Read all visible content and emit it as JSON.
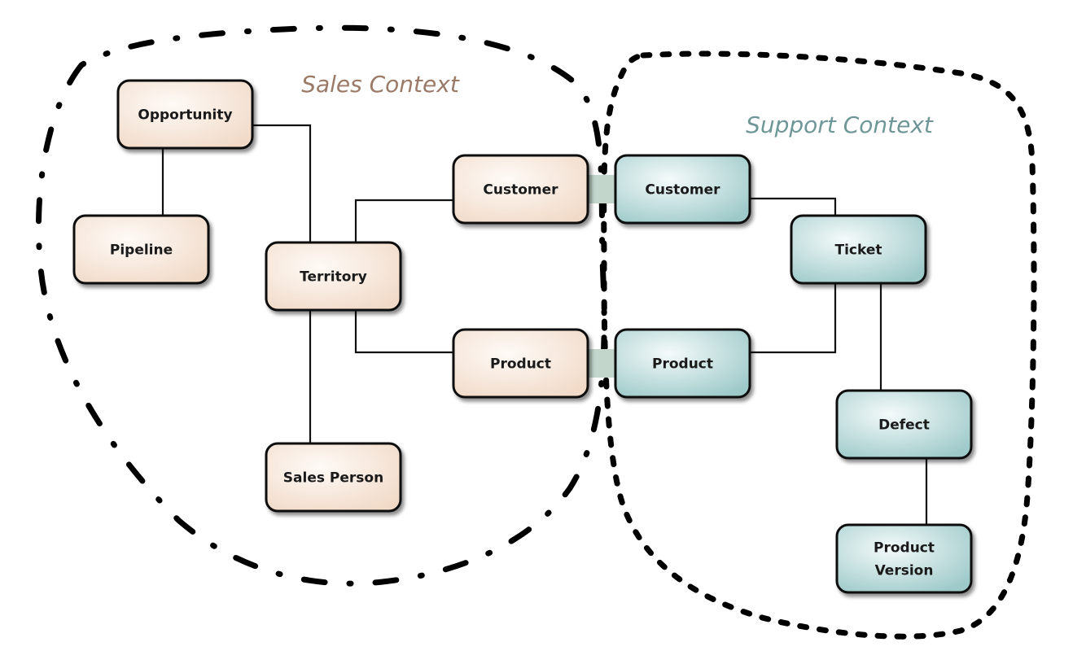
{
  "contexts": [
    {
      "id": "sales",
      "title": "Sales Context",
      "title_color": "#9b7a68",
      "boundary_style": "dash-dot"
    },
    {
      "id": "support",
      "title": "Support Context",
      "title_color": "#6f9797",
      "boundary_style": "dotted"
    }
  ],
  "colors": {
    "sales_fill_center": "#fefaf6",
    "sales_fill_edge": "#f1dac8",
    "support_fill_center": "#f4fafa",
    "support_fill_edge": "#9ec9c9",
    "shared_kernel_band": "#c2d6cc",
    "line": "#111111"
  },
  "nodes": [
    {
      "id": "opportunity",
      "context": "sales",
      "label": [
        "Opportunity"
      ]
    },
    {
      "id": "pipeline",
      "context": "sales",
      "label": [
        "Pipeline"
      ]
    },
    {
      "id": "territory",
      "context": "sales",
      "label": [
        "Territory"
      ]
    },
    {
      "id": "sales-person",
      "context": "sales",
      "label": [
        "Sales Person"
      ]
    },
    {
      "id": "sales-customer",
      "context": "sales",
      "label": [
        "Customer"
      ]
    },
    {
      "id": "sales-product",
      "context": "sales",
      "label": [
        "Product"
      ]
    },
    {
      "id": "support-customer",
      "context": "support",
      "label": [
        "Customer"
      ]
    },
    {
      "id": "support-product",
      "context": "support",
      "label": [
        "Product"
      ]
    },
    {
      "id": "ticket",
      "context": "support",
      "label": [
        "Ticket"
      ]
    },
    {
      "id": "defect",
      "context": "support",
      "label": [
        "Defect"
      ]
    },
    {
      "id": "product-version",
      "context": "support",
      "label": [
        "Product",
        "Version"
      ]
    }
  ],
  "edges": [
    {
      "from": "opportunity",
      "to": "pipeline"
    },
    {
      "from": "opportunity",
      "to": "territory"
    },
    {
      "from": "territory",
      "to": "sales-customer"
    },
    {
      "from": "territory",
      "to": "sales-product"
    },
    {
      "from": "territory",
      "to": "sales-person"
    },
    {
      "from": "support-customer",
      "to": "ticket"
    },
    {
      "from": "support-product",
      "to": "ticket"
    },
    {
      "from": "ticket",
      "to": "defect"
    },
    {
      "from": "defect",
      "to": "product-version"
    }
  ],
  "shared_links": [
    {
      "from": "sales-customer",
      "to": "support-customer"
    },
    {
      "from": "sales-product",
      "to": "support-product"
    }
  ]
}
